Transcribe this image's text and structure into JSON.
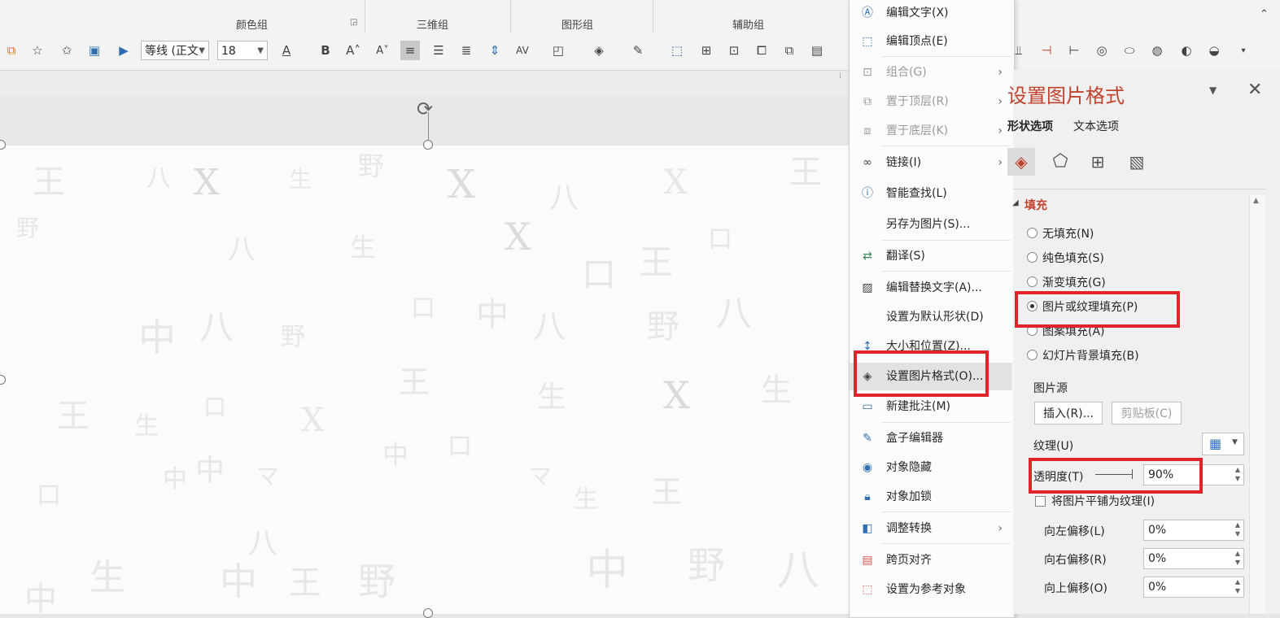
{
  "ribbon": {
    "groups": [
      "颜色组",
      "三维组",
      "图形组",
      "辅助组"
    ],
    "font_name": "等线 (正文",
    "font_size": "18"
  },
  "context_menu": {
    "items": [
      {
        "label": "编辑文字(X)",
        "icon": "edit-text-icon",
        "submenu": false,
        "disabled": false
      },
      {
        "label": "编辑顶点(E)",
        "icon": "edit-points-icon",
        "submenu": false,
        "disabled": false
      },
      {
        "label": "组合(G)",
        "icon": "group-icon",
        "submenu": true,
        "disabled": true
      },
      {
        "label": "置于顶层(R)",
        "icon": "bring-front-icon",
        "submenu": true,
        "disabled": true
      },
      {
        "label": "置于底层(K)",
        "icon": "send-back-icon",
        "submenu": true,
        "disabled": true
      },
      {
        "label": "链接(I)",
        "icon": "link-icon",
        "submenu": true,
        "disabled": false
      },
      {
        "label": "智能查找(L)",
        "icon": "smart-lookup-icon",
        "submenu": false,
        "disabled": false
      },
      {
        "label": "另存为图片(S)...",
        "icon": "",
        "submenu": false,
        "disabled": false
      },
      {
        "label": "翻译(S)",
        "icon": "translate-icon",
        "submenu": false,
        "disabled": false
      },
      {
        "label": "编辑替换文字(A)...",
        "icon": "alt-text-icon",
        "submenu": false,
        "disabled": false
      },
      {
        "label": "设置为默认形状(D)",
        "icon": "",
        "submenu": false,
        "disabled": false
      },
      {
        "label": "大小和位置(Z)...",
        "icon": "size-position-icon",
        "submenu": false,
        "disabled": false
      },
      {
        "label": "设置图片格式(O)...",
        "icon": "format-picture-icon",
        "submenu": false,
        "disabled": false
      },
      {
        "label": "新建批注(M)",
        "icon": "new-comment-icon",
        "submenu": false,
        "disabled": false
      },
      {
        "label": "盒子编辑器",
        "icon": "box-editor-icon",
        "submenu": false,
        "disabled": false
      },
      {
        "label": "对象隐藏",
        "icon": "hide-object-icon",
        "submenu": false,
        "disabled": false
      },
      {
        "label": "对象加锁",
        "icon": "lock-icon",
        "submenu": false,
        "disabled": false
      },
      {
        "label": "调整转换",
        "icon": "convert-icon",
        "submenu": true,
        "disabled": false
      },
      {
        "label": "跨页对齐",
        "icon": "cross-page-align-icon",
        "submenu": false,
        "disabled": false
      },
      {
        "label": "设置为参考对象",
        "icon": "reference-object-icon",
        "submenu": false,
        "disabled": false
      }
    ]
  },
  "pane": {
    "title": "设置图片格式",
    "tab_shape": "形状选项",
    "tab_text": "文本选项",
    "section_fill": "填充",
    "fill_options": [
      {
        "label": "无填充(N)",
        "checked": false
      },
      {
        "label": "纯色填充(S)",
        "checked": false
      },
      {
        "label": "渐变填充(G)",
        "checked": false
      },
      {
        "label": "图片或纹理填充(P)",
        "checked": true
      },
      {
        "label": "图案填充(A)",
        "checked": false
      },
      {
        "label": "幻灯片背景填充(B)",
        "checked": false
      }
    ],
    "picture_source": "图片源",
    "insert_button": "插入(R)...",
    "clipboard_button": "剪贴板(C)",
    "texture_label": "纹理(U)",
    "transparency_label": "透明度(T)",
    "transparency_value": "90%",
    "tile_label": "将图片平铺为纹理(I)",
    "offsets": [
      {
        "label": "向左偏移(L)",
        "value": "0%"
      },
      {
        "label": "向右偏移(R)",
        "value": "0%"
      },
      {
        "label": "向上偏移(O)",
        "value": "0%"
      }
    ]
  },
  "colors": {
    "accent_red": "#e1242b",
    "title_red": "#c1432e"
  }
}
